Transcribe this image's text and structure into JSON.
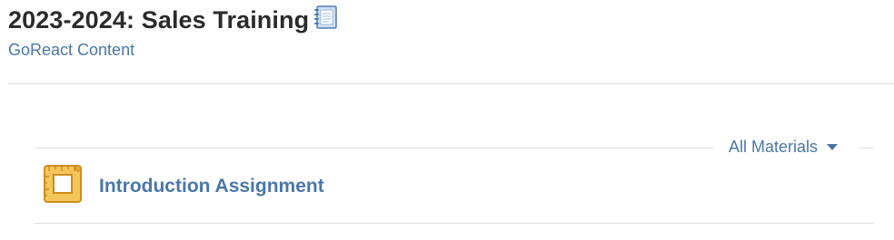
{
  "header": {
    "title": "2023-2024: Sales Training",
    "title_icon": "notebook-icon",
    "org_link": "GoReact Content"
  },
  "filter": {
    "selected": "All Materials",
    "icon": "caret-down-icon"
  },
  "materials": [
    {
      "title": "Introduction Assignment",
      "icon": "assignment-icon"
    }
  ],
  "colors": {
    "link": "#4a77a8",
    "title": "#2b2b2b",
    "divider": "#dddddd",
    "icon_gold": "#e8b84a"
  }
}
